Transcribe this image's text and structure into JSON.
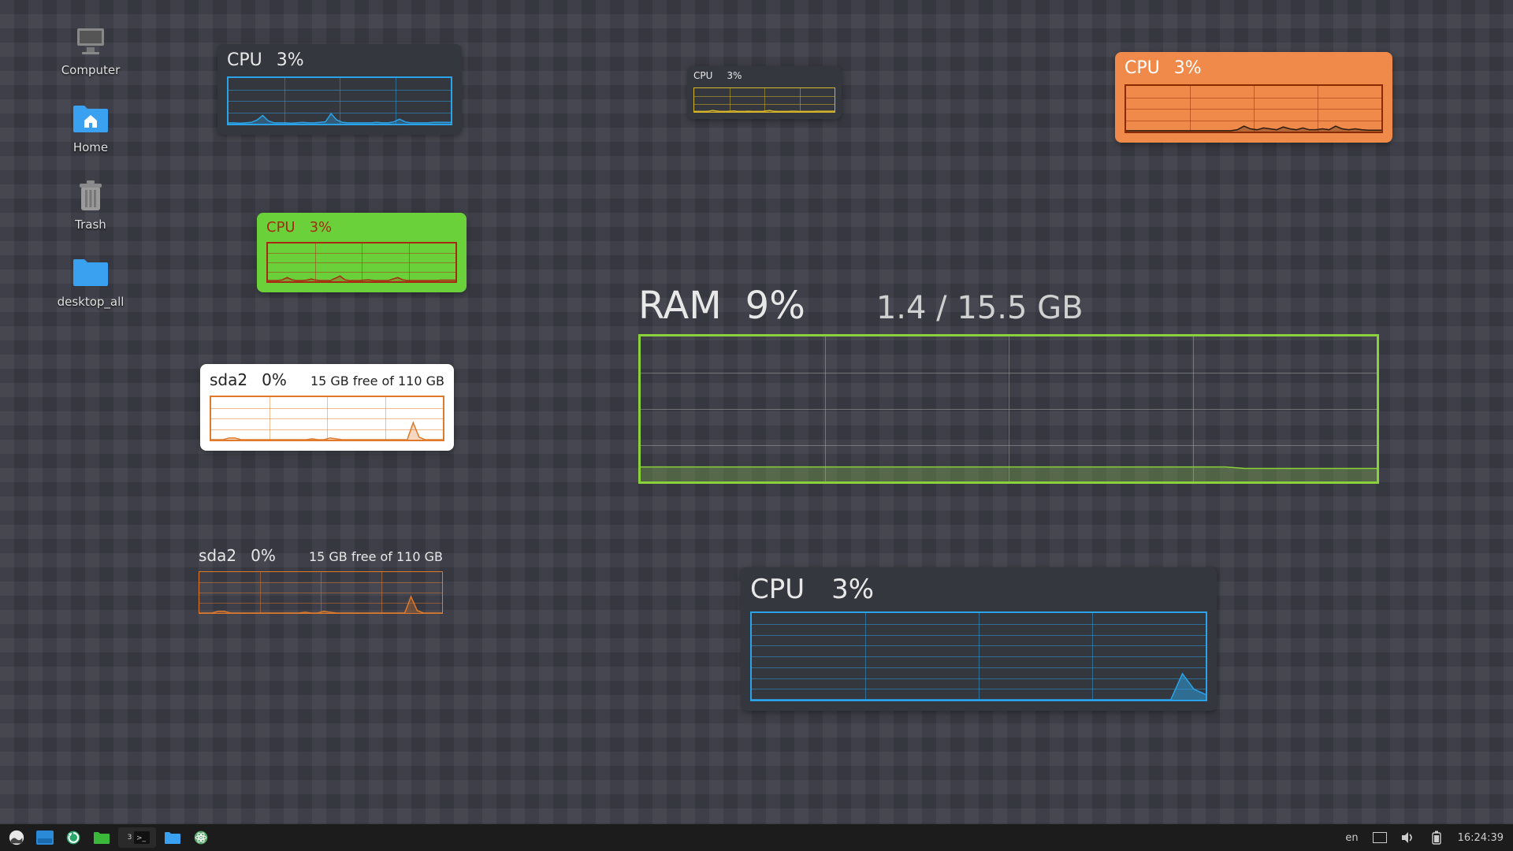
{
  "desktop_icons": {
    "computer": "Computer",
    "home": "Home",
    "trash": "Trash",
    "desktop_all": "desktop_all"
  },
  "widgets": {
    "cpu_blue": {
      "title": "CPU",
      "value": "3%"
    },
    "cpu_yellow": {
      "title": "CPU",
      "value": "3%"
    },
    "cpu_orange": {
      "title": "CPU",
      "value": "3%"
    },
    "cpu_green": {
      "title": "CPU",
      "value": "3%"
    },
    "disk_white": {
      "title": "sda2",
      "value": "0%",
      "detail": "15 GB free of 110 GB"
    },
    "disk_dark": {
      "title": "sda2",
      "value": "0%",
      "detail": "15 GB free of 110 GB"
    },
    "ram": {
      "title": "RAM",
      "value": "9%",
      "detail": "1.4 / 15.5 GB"
    },
    "cpu_big": {
      "title": "CPU",
      "value": "3%"
    }
  },
  "taskbar": {
    "terminal_badge": "3",
    "kbd_layout": "en",
    "clock": "16:24:39"
  },
  "chart_data": [
    {
      "id": "cpu_blue",
      "type": "area",
      "title": "CPU",
      "ylabel": "%",
      "ylim": [
        0,
        100
      ],
      "x": [
        0,
        1,
        2,
        3,
        4,
        5,
        6,
        7,
        8,
        9,
        10,
        11,
        12,
        13,
        14,
        15,
        16,
        17,
        18,
        19,
        20,
        21,
        22,
        23,
        24,
        25,
        26,
        27,
        28,
        29,
        30,
        31,
        32,
        33,
        34,
        35,
        36,
        37,
        38,
        39
      ],
      "values": [
        2,
        2,
        1,
        2,
        3,
        8,
        18,
        6,
        2,
        2,
        2,
        1,
        2,
        3,
        2,
        2,
        3,
        4,
        22,
        8,
        3,
        2,
        2,
        2,
        2,
        2,
        3,
        2,
        2,
        4,
        10,
        4,
        2,
        2,
        2,
        2,
        3,
        3,
        3,
        3
      ]
    },
    {
      "id": "cpu_yellow",
      "type": "area",
      "title": "CPU",
      "ylabel": "%",
      "ylim": [
        0,
        100
      ],
      "x": [
        0,
        1,
        2,
        3,
        4,
        5,
        6,
        7,
        8,
        9,
        10,
        11,
        12,
        13,
        14,
        15,
        16,
        17,
        18,
        19,
        20,
        21,
        22,
        23,
        24,
        25,
        26,
        27,
        28,
        29,
        30,
        31,
        32,
        33,
        34,
        35,
        36,
        37,
        38,
        39
      ],
      "values": [
        2,
        2,
        2,
        2,
        3,
        6,
        4,
        2,
        2,
        2,
        3,
        4,
        2,
        2,
        2,
        3,
        2,
        2,
        2,
        2,
        4,
        6,
        3,
        2,
        2,
        2,
        2,
        3,
        3,
        2,
        2,
        2,
        2,
        2,
        3,
        3,
        3,
        3,
        3,
        3
      ]
    },
    {
      "id": "cpu_orange",
      "type": "area",
      "title": "CPU",
      "ylabel": "%",
      "ylim": [
        0,
        100
      ],
      "x": [
        0,
        1,
        2,
        3,
        4,
        5,
        6,
        7,
        8,
        9,
        10,
        11,
        12,
        13,
        14,
        15,
        16,
        17,
        18,
        19,
        20,
        21,
        22,
        23,
        24,
        25,
        26,
        27,
        28,
        29,
        30,
        31,
        32,
        33,
        34,
        35,
        36,
        37,
        38,
        39
      ],
      "values": [
        2,
        2,
        2,
        2,
        2,
        2,
        2,
        2,
        2,
        2,
        2,
        2,
        2,
        2,
        2,
        2,
        2,
        4,
        12,
        6,
        4,
        8,
        6,
        4,
        10,
        6,
        4,
        8,
        4,
        4,
        6,
        4,
        12,
        6,
        4,
        6,
        4,
        3,
        3,
        3
      ]
    },
    {
      "id": "cpu_green",
      "type": "area",
      "title": "CPU",
      "ylabel": "%",
      "ylim": [
        0,
        100
      ],
      "x": [
        0,
        1,
        2,
        3,
        4,
        5,
        6,
        7,
        8,
        9,
        10,
        11,
        12,
        13,
        14,
        15,
        16,
        17,
        18,
        19,
        20,
        21,
        22,
        23,
        24,
        25,
        26,
        27,
        28,
        29,
        30,
        31,
        32,
        33,
        34,
        35,
        36,
        37,
        38,
        39
      ],
      "values": [
        2,
        2,
        2,
        4,
        10,
        4,
        2,
        2,
        3,
        6,
        3,
        2,
        2,
        2,
        8,
        14,
        4,
        2,
        2,
        2,
        3,
        4,
        2,
        2,
        2,
        2,
        6,
        10,
        4,
        2,
        2,
        2,
        2,
        2,
        2,
        2,
        3,
        3,
        3,
        3
      ]
    },
    {
      "id": "disk_white",
      "type": "area",
      "title": "sda2",
      "ylabel": "%",
      "ylim": [
        0,
        100
      ],
      "x": [
        0,
        1,
        2,
        3,
        4,
        5,
        6,
        7,
        8,
        9,
        10,
        11,
        12,
        13,
        14,
        15,
        16,
        17,
        18,
        19,
        20,
        21,
        22,
        23,
        24,
        25,
        26,
        27,
        28,
        29,
        30,
        31,
        32,
        33,
        34,
        35,
        36,
        37,
        38,
        39
      ],
      "values": [
        0,
        0,
        0,
        4,
        4,
        0,
        0,
        0,
        0,
        0,
        0,
        0,
        0,
        0,
        0,
        0,
        0,
        2,
        0,
        0,
        4,
        2,
        0,
        0,
        0,
        0,
        0,
        0,
        0,
        0,
        0,
        0,
        0,
        0,
        40,
        6,
        0,
        0,
        0,
        0
      ]
    },
    {
      "id": "disk_dark",
      "type": "area",
      "title": "sda2",
      "ylabel": "%",
      "ylim": [
        0,
        100
      ],
      "x": [
        0,
        1,
        2,
        3,
        4,
        5,
        6,
        7,
        8,
        9,
        10,
        11,
        12,
        13,
        14,
        15,
        16,
        17,
        18,
        19,
        20,
        21,
        22,
        23,
        24,
        25,
        26,
        27,
        28,
        29,
        30,
        31,
        32,
        33,
        34,
        35,
        36,
        37,
        38,
        39
      ],
      "values": [
        0,
        0,
        0,
        4,
        4,
        0,
        0,
        0,
        0,
        0,
        0,
        0,
        0,
        0,
        0,
        0,
        0,
        2,
        0,
        0,
        4,
        2,
        0,
        0,
        0,
        0,
        0,
        0,
        0,
        0,
        0,
        0,
        0,
        0,
        40,
        6,
        0,
        0,
        0,
        0
      ]
    },
    {
      "id": "ram",
      "type": "line",
      "title": "RAM",
      "ylabel": "%",
      "ylim": [
        0,
        100
      ],
      "x": [
        0,
        1,
        2,
        3,
        4,
        5,
        6,
        7,
        8,
        9,
        10,
        11,
        12,
        13,
        14,
        15,
        16,
        17,
        18,
        19,
        20,
        21,
        22,
        23,
        24,
        25,
        26,
        27,
        28,
        29,
        30,
        31,
        32,
        33,
        34,
        35,
        36,
        37,
        38,
        39
      ],
      "values": [
        10,
        10,
        10,
        10,
        10,
        10,
        10,
        10,
        10,
        10,
        10,
        10,
        10,
        10,
        10,
        10,
        10,
        10,
        10,
        10,
        10,
        10,
        10,
        10,
        10,
        10,
        10,
        10,
        10,
        10,
        10,
        10,
        9,
        9,
        9,
        9,
        9,
        9,
        9,
        9
      ]
    },
    {
      "id": "cpu_big",
      "type": "area",
      "title": "CPU",
      "ylabel": "%",
      "ylim": [
        0,
        100
      ],
      "x": [
        0,
        1,
        2,
        3,
        4,
        5,
        6,
        7,
        8,
        9,
        10,
        11,
        12,
        13,
        14,
        15,
        16,
        17,
        18,
        19,
        20,
        21,
        22,
        23,
        24,
        25,
        26,
        27,
        28,
        29,
        30,
        31,
        32,
        33,
        34,
        35,
        36,
        37,
        38,
        39
      ],
      "values": [
        0,
        0,
        0,
        0,
        0,
        0,
        0,
        0,
        0,
        0,
        0,
        0,
        0,
        0,
        0,
        0,
        0,
        0,
        0,
        0,
        0,
        0,
        0,
        0,
        0,
        0,
        0,
        0,
        0,
        0,
        0,
        0,
        0,
        0,
        0,
        0,
        0,
        30,
        12,
        6
      ]
    }
  ]
}
